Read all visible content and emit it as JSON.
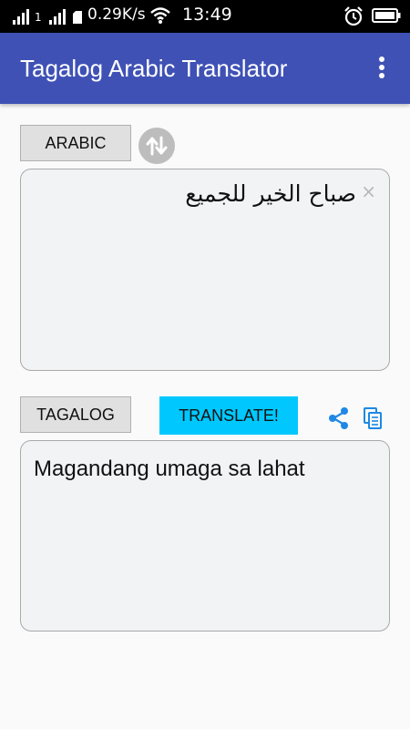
{
  "status_bar": {
    "speed": "0.29K/s",
    "time": "13:49",
    "sim1_label": "1",
    "icons": [
      "signal-icon",
      "signal-icon",
      "wifi-icon",
      "alarm-icon",
      "battery-icon"
    ]
  },
  "app_bar": {
    "title": "Tagalog Arabic Translator"
  },
  "source": {
    "language_label": "ARABIC",
    "text": "صباح الخير للجميع",
    "clear_glyph": "×"
  },
  "target": {
    "language_label": "TAGALOG",
    "text": "Magandang umaga sa lahat"
  },
  "actions": {
    "translate_label": "TRANSLATE!"
  },
  "colors": {
    "app_bar": "#3f51b5",
    "translate_button": "#00c8ff",
    "action_icons": "#1e88e5"
  }
}
